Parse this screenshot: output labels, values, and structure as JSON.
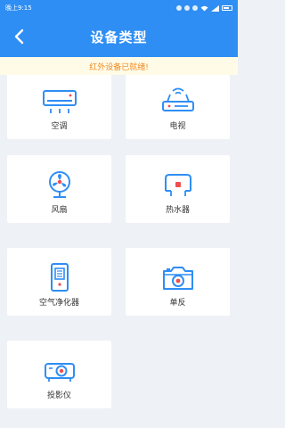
{
  "status_bar": {
    "time": "晚上9:15"
  },
  "header": {
    "title": "设备类型"
  },
  "notice": {
    "text": "红外设备已就绪!"
  },
  "devices": [
    {
      "label": "空调",
      "icon": "air-conditioner-icon"
    },
    {
      "label": "电视",
      "icon": "tv-router-icon"
    },
    {
      "label": "风扇",
      "icon": "fan-icon"
    },
    {
      "label": "热水器",
      "icon": "water-heater-icon"
    },
    {
      "label": "空气净化器",
      "icon": "air-purifier-icon"
    },
    {
      "label": "单反",
      "icon": "camera-icon"
    },
    {
      "label": "投影仪",
      "icon": "projector-icon"
    }
  ],
  "colors": {
    "primary": "#2f8ef4",
    "notice_bg": "#fffbe6",
    "notice_text": "#f08a24",
    "background": "#eef1f5"
  }
}
